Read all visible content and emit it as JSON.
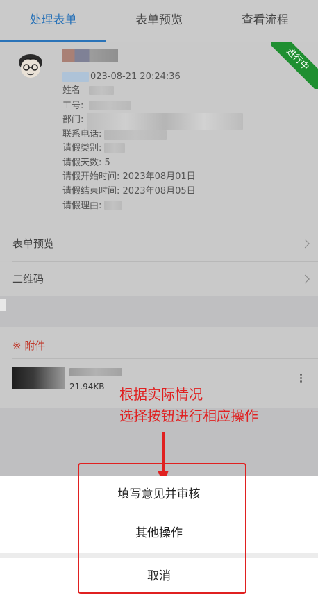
{
  "tabs": [
    {
      "label": "处理表单",
      "active": true
    },
    {
      "label": "表单预览",
      "active": false
    },
    {
      "label": "查看流程",
      "active": false
    }
  ],
  "status_ribbon": "进行中",
  "applicant": {
    "submitted_time": "023-08-21 20:24:36",
    "fields": {
      "name": "姓名",
      "employee_id": "工号:",
      "department": "部门:",
      "phone": "联系电话:",
      "leave_type": "请假类别:",
      "leave_days": "请假天数: 5",
      "start_time": "请假开始时间: 2023年08月01日",
      "end_time": "请假结束时间: 2023年08月05日",
      "reason": "请假理由:"
    }
  },
  "links": {
    "form_preview": "表单预览",
    "qr_code": "二维码"
  },
  "attachments": {
    "title": "※ 附件",
    "file_size": "21.94KB"
  },
  "annotation": {
    "line1": "根据实际情况",
    "line2": "选择按钮进行相应操作"
  },
  "action_sheet": {
    "approve_label": "填写意见并审核",
    "other_label": "其他操作",
    "cancel_label": "取消"
  },
  "colors": {
    "accent": "#2a73b8",
    "ribbon": "#1f8f31",
    "annotation": "#e02020"
  }
}
